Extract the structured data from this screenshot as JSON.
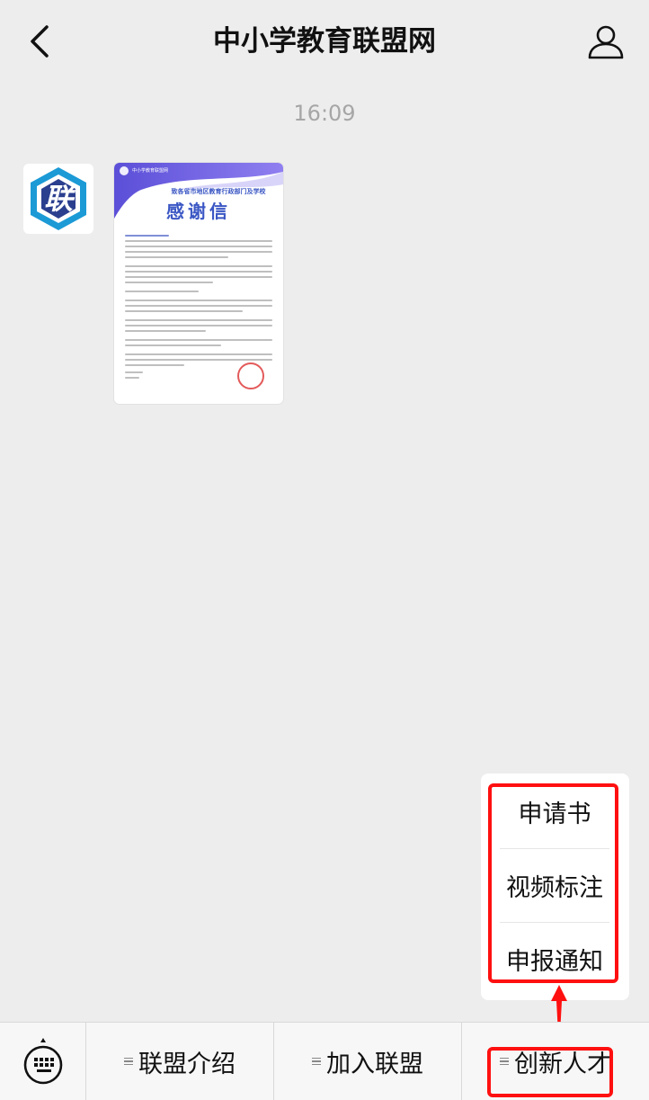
{
  "header": {
    "title": "中小学教育联盟网",
    "back_icon": "chevron-left-icon",
    "profile_icon": "person-icon"
  },
  "chat": {
    "timestamp": "16:09",
    "avatar": {
      "char": "联",
      "icon": "alliance-logo-icon",
      "colors": {
        "outer": "#1b9ad6",
        "inner": "#2b3f8f"
      }
    },
    "document_card": {
      "header_text": "中小学教育联盟网",
      "subtitle": "致各省市地区教育行政部门及学校",
      "title": "感谢信",
      "seal_color": "#e35a5a"
    }
  },
  "menu": {
    "items": [
      {
        "label": "申请书"
      },
      {
        "label": "视频标注"
      },
      {
        "label": "申报通知"
      }
    ]
  },
  "bottom_bar": {
    "keyboard_icon": "keyboard-icon",
    "tabs": [
      {
        "label": "联盟介绍"
      },
      {
        "label": "加入联盟"
      },
      {
        "label": "创新人才"
      }
    ]
  },
  "colors": {
    "background": "#ededed",
    "highlight": "#ff1010",
    "doc_accent": "#3b57c4"
  }
}
